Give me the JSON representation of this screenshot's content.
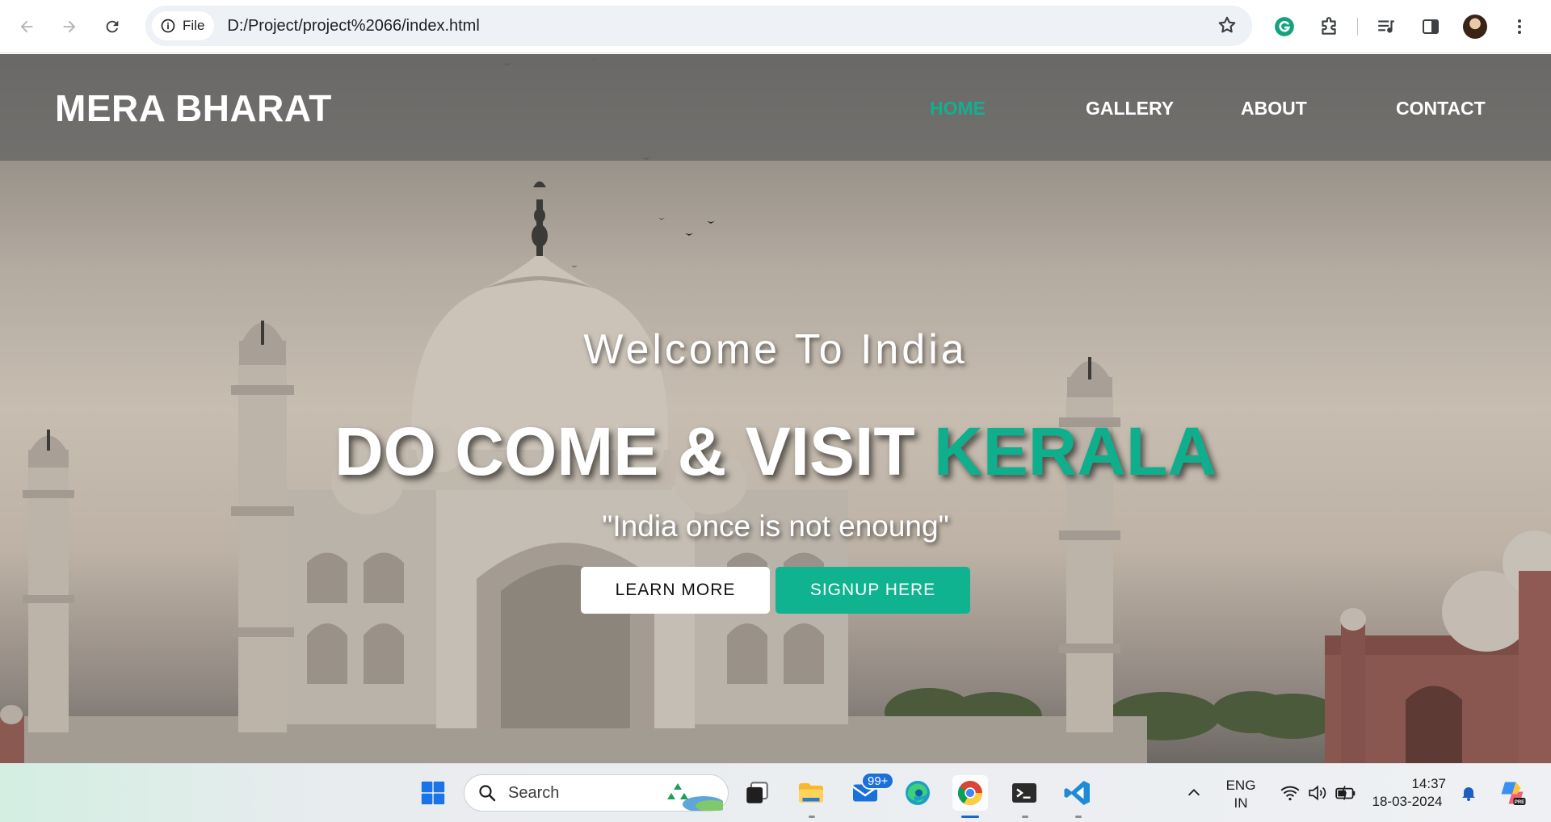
{
  "browser": {
    "site_chip_label": "File",
    "url": "D:/Project/project%2066/index.html"
  },
  "site": {
    "logo": "MERA BHARAT",
    "nav": [
      {
        "label": "HOME",
        "active": true
      },
      {
        "label": "GALLERY",
        "active": false
      },
      {
        "label": "ABOUT",
        "active": false
      },
      {
        "label": "CONTACT",
        "active": false
      }
    ],
    "hero": {
      "welcome": "Welcome To India",
      "title_main": "DO COME & VISIT",
      "title_accent": "KERALA",
      "quote": "\"India once is not enoung\"",
      "learn_more": "LEARN MORE",
      "signup": "SIGNUP HERE"
    },
    "colors": {
      "accent": "#10b38f",
      "header_bg": "#6a6967"
    }
  },
  "taskbar": {
    "search_placeholder": "Search",
    "mail_badge": "99+",
    "language": "ENG",
    "region": "IN",
    "time": "14:37",
    "date": "18-03-2024",
    "icons": [
      "windows-start-icon",
      "search-icon",
      "task-view-icon",
      "file-explorer-icon",
      "mail-icon",
      "edge-icon",
      "chrome-icon",
      "terminal-icon",
      "vscode-icon",
      "chevron-up-icon",
      "wifi-icon",
      "volume-icon",
      "battery-icon",
      "bell-icon",
      "copilot-icon"
    ]
  }
}
